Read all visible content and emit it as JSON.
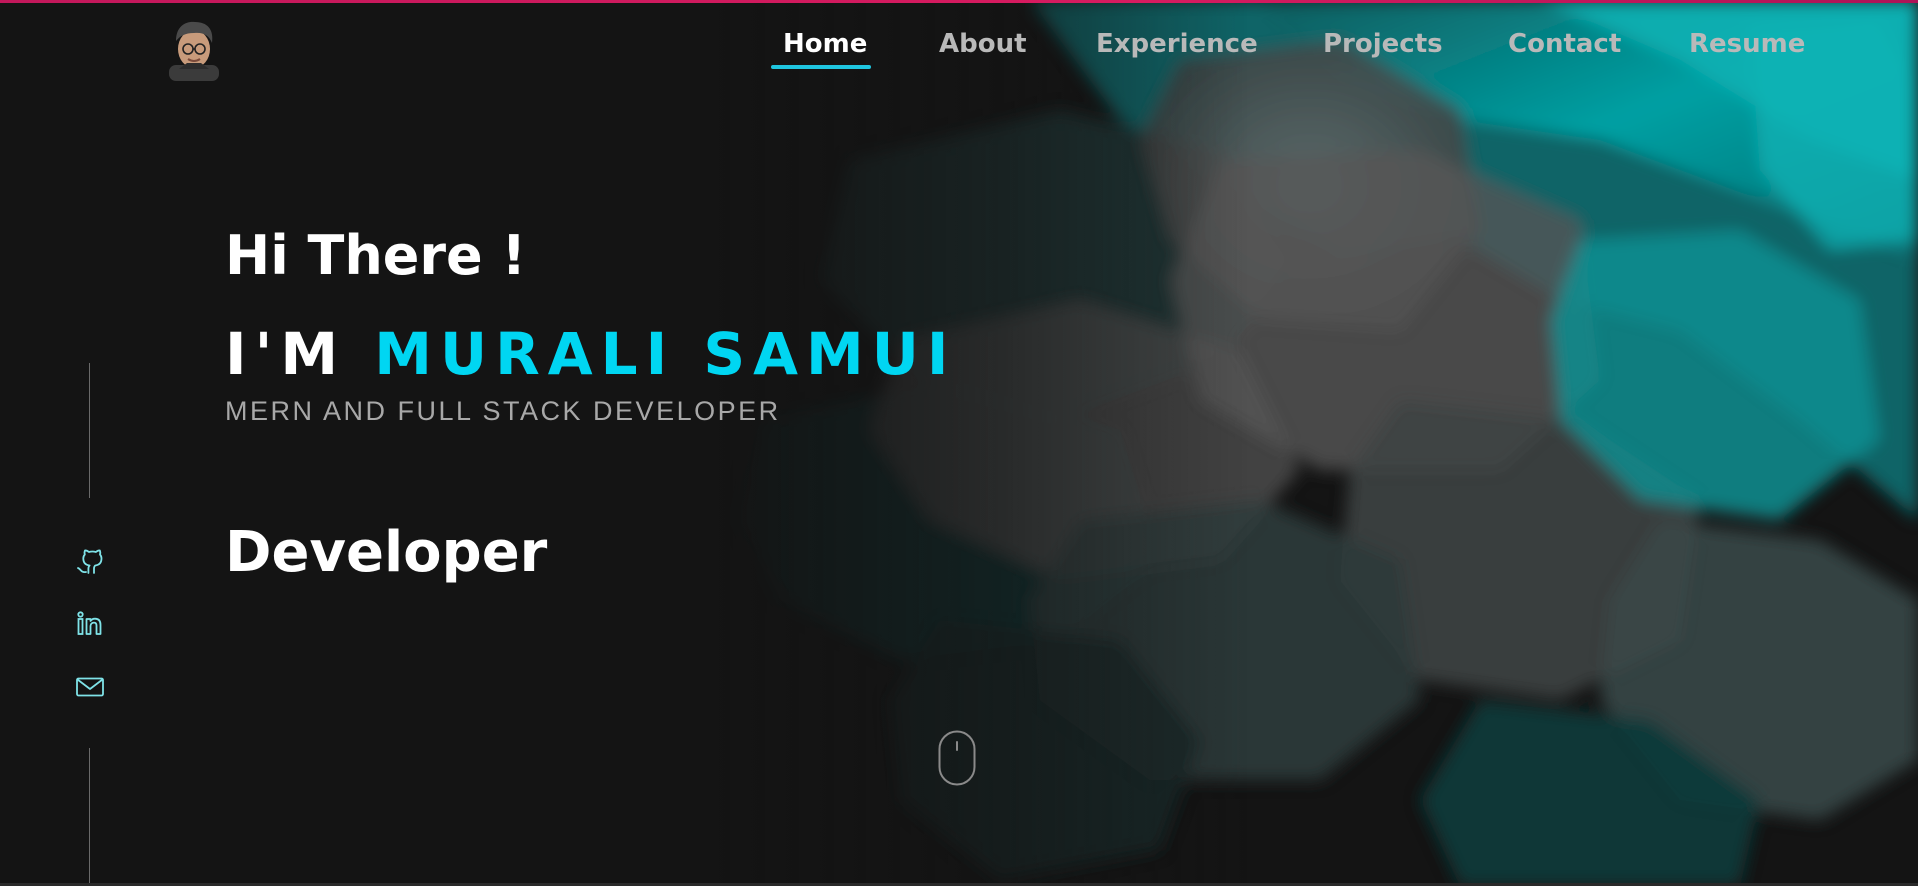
{
  "nav": {
    "items": [
      {
        "label": "Home",
        "active": true
      },
      {
        "label": "About",
        "active": false
      },
      {
        "label": "Experience",
        "active": false
      },
      {
        "label": "Projects",
        "active": false
      },
      {
        "label": "Contact",
        "active": false
      },
      {
        "label": "Resume",
        "active": false
      }
    ],
    "logo_icon": "avatar-cartoon-icon"
  },
  "hero": {
    "greeting": "Hi There !",
    "name_prefix": "I'M",
    "name_highlight": "MURALI SAMUI",
    "role": "MERN AND FULL STACK DEVELOPER",
    "typed_word": "Developer"
  },
  "social": {
    "icons": [
      "github-icon",
      "linkedin-icon",
      "mail-icon"
    ]
  },
  "scroll_indicator": {
    "icon": "mouse-scroll-icon"
  },
  "colors": {
    "background": "#141414",
    "accent": "#00d6f2",
    "nav_underline": "#1fc6e0",
    "social_icon": "#7fe3e8",
    "top_strip": "#d81b60",
    "art_teal": "#00a3a6",
    "art_gray": "#5c5c5c"
  }
}
